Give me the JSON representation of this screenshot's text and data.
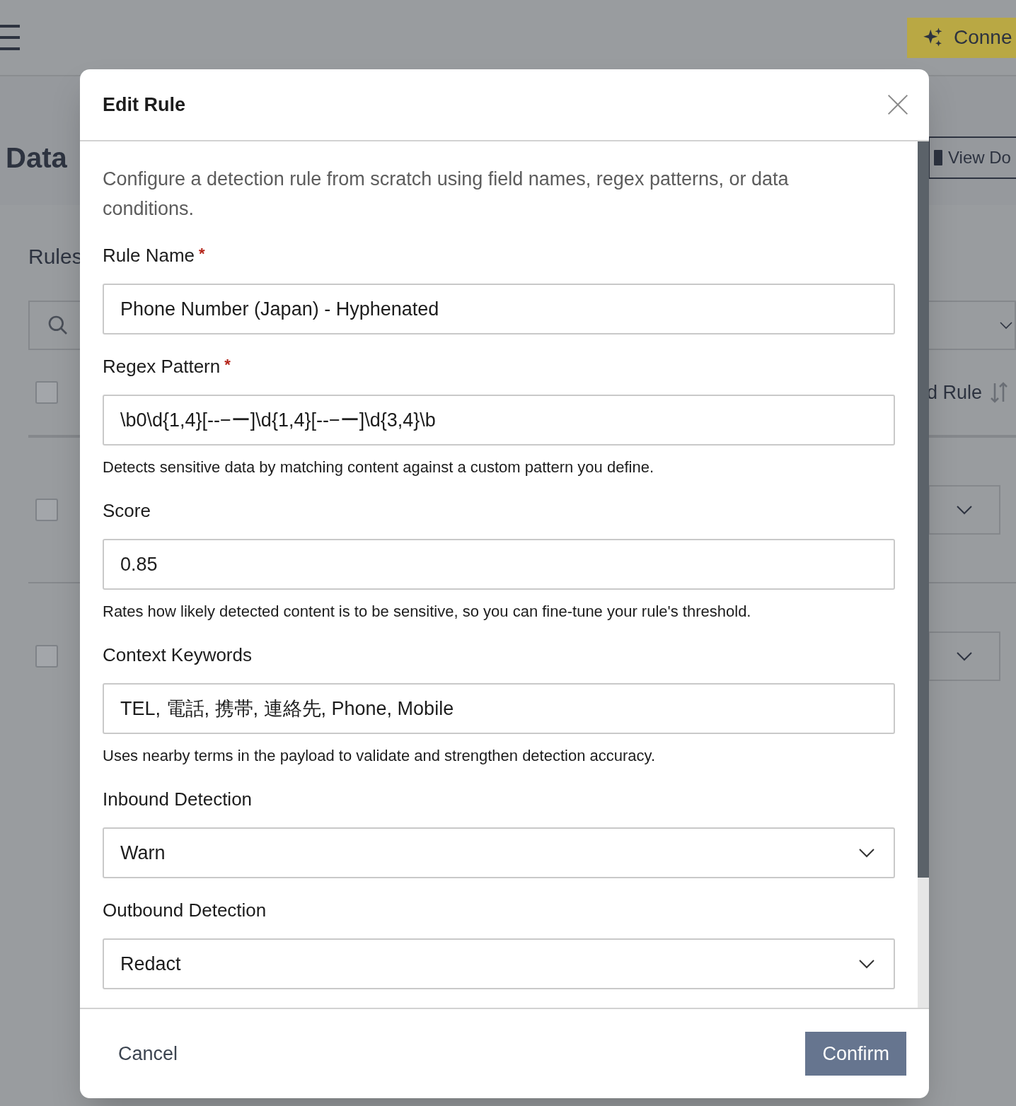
{
  "background": {
    "connect_button": {
      "label": "Conne"
    },
    "page_title": "Data",
    "view_button": {
      "label": "View Do"
    },
    "section_title": "Rules",
    "table": {
      "header": {
        "checked": false,
        "column_label": "d Rule"
      },
      "rows": [
        {
          "checked": false
        },
        {
          "checked": false
        }
      ]
    }
  },
  "dialog": {
    "title": "Edit Rule",
    "description": "Configure a detection rule from scratch using field names, regex patterns, or data conditions.",
    "fields": [
      {
        "kind": "text",
        "label": "Rule Name",
        "required_mark": "*",
        "value": "Phone Number (Japan) - Hyphenated"
      },
      {
        "kind": "text",
        "label": "Regex Pattern",
        "required_mark": "*",
        "value": "\\b0\\d{1,4}[-‐−ー]\\d{1,4}[-‐−ー]\\d{3,4}\\b",
        "help": "Detects sensitive data by matching content against a custom pattern you define."
      },
      {
        "kind": "text",
        "label": "Score",
        "value": "0.85",
        "help": "Rates how likely detected content is to be sensitive, so you can fine-tune your rule's threshold."
      },
      {
        "kind": "text",
        "label": "Context Keywords",
        "value": "TEL, 電話, 携帯, 連絡先, Phone, Mobile",
        "help": "Uses nearby terms in the payload to validate and strengthen detection accuracy."
      },
      {
        "kind": "select",
        "label": "Inbound Detection",
        "value": "Warn"
      },
      {
        "kind": "select",
        "label": "Outbound Detection",
        "value": "Redact"
      }
    ],
    "cancel_button": "Cancel",
    "confirm_button": "Confirm"
  }
}
